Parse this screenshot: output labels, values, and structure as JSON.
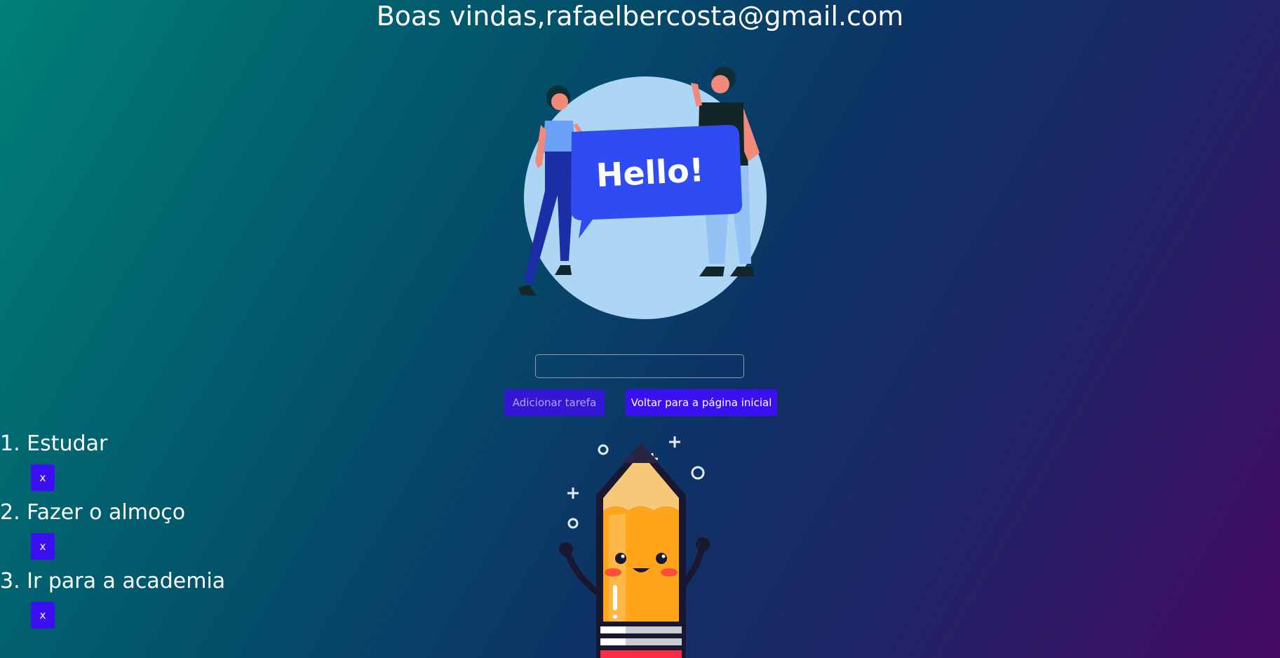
{
  "header": {
    "title": "Boas vindas,rafaelbercosta@gmail.com"
  },
  "illustrations": {
    "hello_text": "Hello!",
    "hello_icon": "people-holding-hello-sign-illustration",
    "pencil_icon": "smiling-pencil-mascot-illustration"
  },
  "task_form": {
    "input_value": "",
    "input_placeholder": "",
    "add_button_label": "Adicionar tarefa",
    "back_button_label": "Voltar para a página inicial"
  },
  "tasks": [
    {
      "label": "1. Estudar",
      "remove_label": "x"
    },
    {
      "label": "2. Fazer o almoço",
      "remove_label": "x"
    },
    {
      "label": "3. Ir para a academia",
      "remove_label": "x"
    }
  ],
  "colors": {
    "button_primary": "#3a10f2",
    "button_add": "#3416d6",
    "add_button_text": "#b3a6e3",
    "text": "#ffffff",
    "background_start": "#008077",
    "background_end": "#460a62"
  }
}
